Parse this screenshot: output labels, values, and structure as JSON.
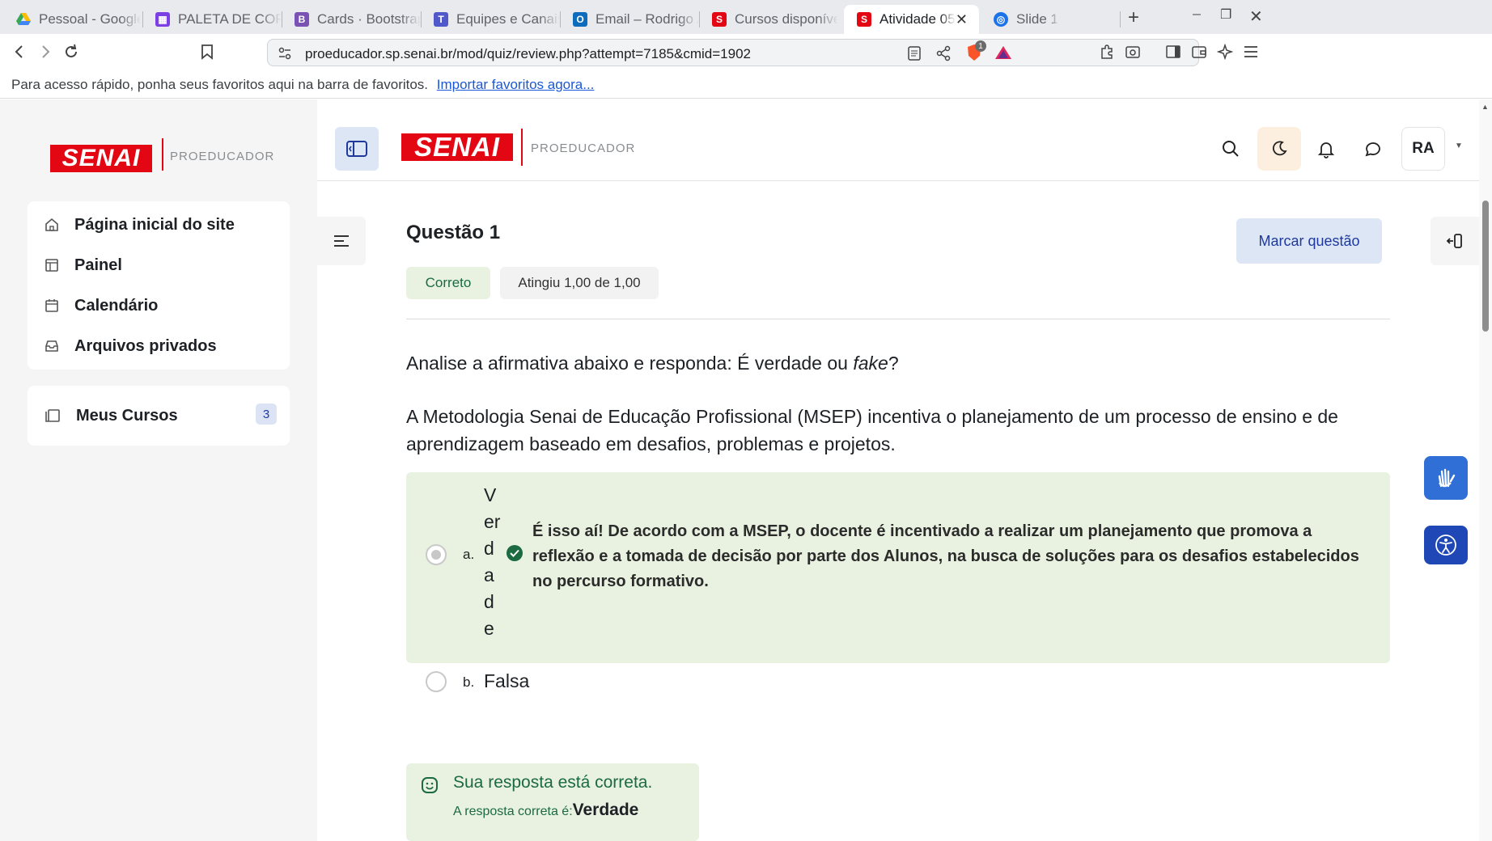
{
  "browser": {
    "tabs": [
      {
        "label": "Pessoal - Google",
        "icon": "google-drive-icon",
        "color": "#34a853"
      },
      {
        "label": "PALETA DE CORE",
        "icon": "calendar-icon",
        "color": "#7b3fe4"
      },
      {
        "label": "Cards · Bootstrap",
        "icon": "bootstrap-icon",
        "color": "#7952b3"
      },
      {
        "label": "Equipes e Canais",
        "icon": "teams-icon",
        "color": "#5059c9"
      },
      {
        "label": "Email – Rodrigo A",
        "icon": "outlook-icon",
        "color": "#0f6cbd"
      },
      {
        "label": "Cursos disponíve",
        "icon": "senai-s-icon",
        "color": "#e30613"
      },
      {
        "label": "Atividade 05",
        "icon": "senai-s-icon",
        "color": "#e30613"
      },
      {
        "label": "Slide 1",
        "icon": "globe-icon",
        "color": "#1a73e8"
      }
    ],
    "url": "proeducador.sp.senai.br/mod/quiz/review.php?attempt=7185&cmid=1902",
    "brave_badge": "1",
    "bookmarks_text": "Para acesso rápido, ponha seus favoritos aqui na barra de favoritos.",
    "bookmarks_link": "Importar favoritos agora..."
  },
  "logo": {
    "brand": "SENAI",
    "subtitle": "PROEDUCADOR"
  },
  "sidebar": {
    "items": [
      {
        "label": "Página inicial do site",
        "icon": "home-icon"
      },
      {
        "label": "Painel",
        "icon": "dashboard-icon"
      },
      {
        "label": "Calendário",
        "icon": "calendar-icon"
      },
      {
        "label": "Arquivos privados",
        "icon": "inbox-icon"
      }
    ],
    "courses": {
      "label": "Meus Cursos",
      "count": "3"
    }
  },
  "header": {
    "user_initials": "RA"
  },
  "question": {
    "title": "Questão 1",
    "state": "Correto",
    "grade": "Atingiu 1,00 de 1,00",
    "flag_label": "Marcar questão",
    "prompt": "Analise a afirmativa abaixo e responda: É verdade ou ",
    "prompt_em": "fake",
    "prompt_end": "?",
    "statement": "A Metodologia Senai de Educação Profissional (MSEP) incentiva o planejamento de um processo de ensino e de aprendizagem baseado em desafios, problemas e projetos.",
    "options": [
      {
        "letter": "a.",
        "text": "Verdade",
        "selected": true,
        "correct": true,
        "feedback": "É isso aí! De acordo com a MSEP, o docente é incentivado a realizar um planejamento que promova a reflexão e a tomada de decisão por parte dos Alunos, na busca de soluções para os desafios estabelecidos no percurso formativo."
      },
      {
        "letter": "b.",
        "text": "Falsa",
        "selected": false,
        "correct": false,
        "feedback": ""
      }
    ],
    "result_title": "Sua resposta está correta.",
    "result_label": "A resposta correta é:",
    "result_value": "Verdade"
  },
  "colors": {
    "brand_red": "#e30613",
    "success_bg": "#e9f2e0",
    "success_text": "#1c6a3f",
    "accent_blue": "#2f6fd6"
  }
}
